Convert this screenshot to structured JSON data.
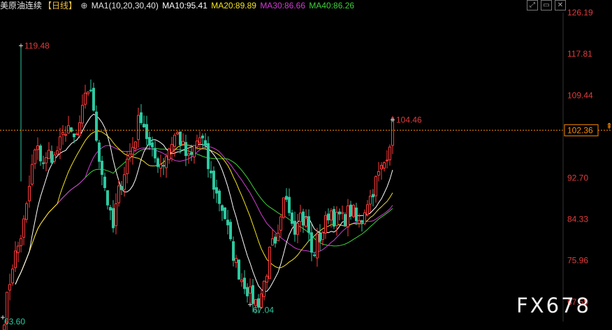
{
  "header": {
    "instrument": "美原油连续",
    "period": "【日线】",
    "settings_icon": "gear-icon",
    "ma_group": "MA1(10,20,30,40)",
    "ma10": "MA10:95.41",
    "ma20": "MA20:89.89",
    "ma30": "MA30:86.66",
    "ma40": "MA40:86.26"
  },
  "toolbar": {
    "icons": [
      "expand-icon",
      "window-icon",
      "close-icon"
    ]
  },
  "watermark": "FX678",
  "colors": {
    "background": "#000000",
    "up": "#ff3a3a",
    "down": "#2ec8a0",
    "ma10": "#ffffff",
    "ma20": "#f5e41e",
    "ma30": "#d33cd6",
    "ma40": "#3ed23a",
    "price_line": "#ff8c00",
    "axis_text": "#e23b3b"
  },
  "chart_data": {
    "type": "candlestick",
    "ylim": [
      63.6,
      126.19
    ],
    "yticks": [
      "126.19",
      "117.81",
      "109.44",
      "102.36",
      "92.70",
      "84.33",
      "75.96",
      "67.59"
    ],
    "current_price": "102.36",
    "annotations": {
      "high": "119.48",
      "low_left": "63.60",
      "low_mid": "67.04",
      "last_high": "104.46"
    },
    "moving_averages": [
      {
        "name": "MA10",
        "last": 95.41
      },
      {
        "name": "MA20",
        "last": 89.89
      },
      {
        "name": "MA30",
        "last": 86.66
      },
      {
        "name": "MA40",
        "last": 86.26
      }
    ],
    "close_path": [
      [
        0,
        64.5
      ],
      [
        4,
        70.5
      ],
      [
        8,
        76
      ],
      [
        12,
        78.5
      ],
      [
        16,
        82
      ],
      [
        20,
        87
      ],
      [
        24,
        94
      ],
      [
        28,
        99
      ],
      [
        32,
        97
      ],
      [
        36,
        95.5
      ],
      [
        40,
        98
      ],
      [
        44,
        96.5
      ],
      [
        48,
        99
      ],
      [
        52,
        101
      ],
      [
        56,
        104
      ],
      [
        60,
        100
      ],
      [
        64,
        101
      ],
      [
        68,
        105
      ],
      [
        72,
        109
      ],
      [
        76,
        112
      ],
      [
        80,
        103
      ],
      [
        84,
        97
      ],
      [
        88,
        92
      ],
      [
        92,
        87
      ],
      [
        96,
        82
      ],
      [
        100,
        89
      ],
      [
        104,
        92
      ],
      [
        108,
        96
      ],
      [
        112,
        98
      ],
      [
        116,
        101
      ],
      [
        120,
        106
      ],
      [
        124,
        103
      ],
      [
        128,
        99
      ],
      [
        132,
        97
      ],
      [
        136,
        96
      ],
      [
        140,
        95.5
      ],
      [
        144,
        98
      ],
      [
        148,
        100
      ],
      [
        152,
        102
      ],
      [
        156,
        100
      ],
      [
        160,
        97.5
      ],
      [
        164,
        96
      ],
      [
        168,
        99
      ],
      [
        172,
        101
      ],
      [
        176,
        100
      ],
      [
        180,
        95
      ],
      [
        184,
        92
      ],
      [
        188,
        89
      ],
      [
        192,
        87
      ],
      [
        196,
        84
      ],
      [
        200,
        79
      ],
      [
        204,
        76
      ],
      [
        208,
        73
      ],
      [
        212,
        71.5
      ],
      [
        216,
        69.5
      ],
      [
        220,
        68
      ],
      [
        224,
        67.3
      ],
      [
        228,
        70
      ],
      [
        232,
        74
      ],
      [
        236,
        79.5
      ],
      [
        240,
        78
      ],
      [
        244,
        83
      ],
      [
        248,
        90
      ],
      [
        252,
        87
      ],
      [
        256,
        82
      ],
      [
        260,
        86
      ],
      [
        264,
        84
      ],
      [
        268,
        83.5
      ],
      [
        272,
        76
      ],
      [
        276,
        80
      ],
      [
        280,
        81
      ],
      [
        284,
        84
      ],
      [
        288,
        86.5
      ],
      [
        292,
        84
      ],
      [
        296,
        85
      ],
      [
        300,
        84
      ],
      [
        304,
        86
      ],
      [
        308,
        86
      ],
      [
        312,
        83
      ],
      [
        316,
        84.5
      ],
      [
        320,
        88
      ],
      [
        324,
        89
      ],
      [
        328,
        92
      ],
      [
        332,
        94
      ],
      [
        336,
        96
      ],
      [
        340,
        99.5
      ],
      [
        343,
        103.5
      ]
    ]
  }
}
